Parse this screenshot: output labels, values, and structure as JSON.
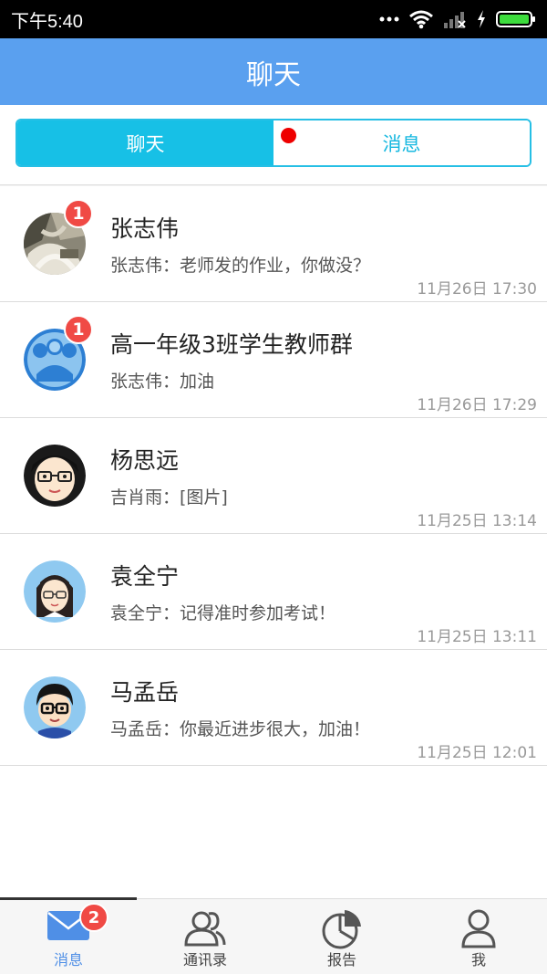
{
  "status_bar": {
    "time": "下午5:40",
    "icons": [
      "more-dots-icon",
      "wifi-icon",
      "signal-icon",
      "charging-icon",
      "battery-icon"
    ]
  },
  "header": {
    "title": "聊天"
  },
  "segmented": {
    "tabs": [
      {
        "label": "聊天",
        "active": true
      },
      {
        "label": "消息",
        "active": false,
        "has_red_dot": true
      }
    ]
  },
  "chats": [
    {
      "name": "张志伟",
      "preview": "张志伟：老师发的作业，你做没？",
      "time": "11月26日 17:30",
      "unread": "1",
      "avatar": "photo"
    },
    {
      "name": "高一年级3班学生教师群",
      "preview": "张志伟：加油",
      "time": "11月26日 17:29",
      "unread": "1",
      "avatar": "group"
    },
    {
      "name": "杨思远",
      "preview": "吉肖雨：[图片]",
      "time": "11月25日 13:14",
      "unread": null,
      "avatar": "girl-glasses"
    },
    {
      "name": "袁全宁",
      "preview": "袁全宁：记得准时参加考试！",
      "time": "11月25日 13:11",
      "unread": null,
      "avatar": "girl-long-hair"
    },
    {
      "name": "马孟岳",
      "preview": "马孟岳：你最近进步很大，加油！",
      "time": "11月25日 12:01",
      "unread": null,
      "avatar": "boy-glasses"
    }
  ],
  "bottom_nav": {
    "items": [
      {
        "label": "消息",
        "icon": "mail-icon",
        "active": true,
        "badge": "2"
      },
      {
        "label": "通讯录",
        "icon": "contacts-icon",
        "active": false
      },
      {
        "label": "报告",
        "icon": "pie-chart-icon",
        "active": false
      },
      {
        "label": "我",
        "icon": "user-icon",
        "active": false
      }
    ]
  },
  "colors": {
    "header": "#5aa0ef",
    "segment_active": "#17c0e6",
    "badge": "#f04a45",
    "nav_active": "#4f8fe6"
  }
}
